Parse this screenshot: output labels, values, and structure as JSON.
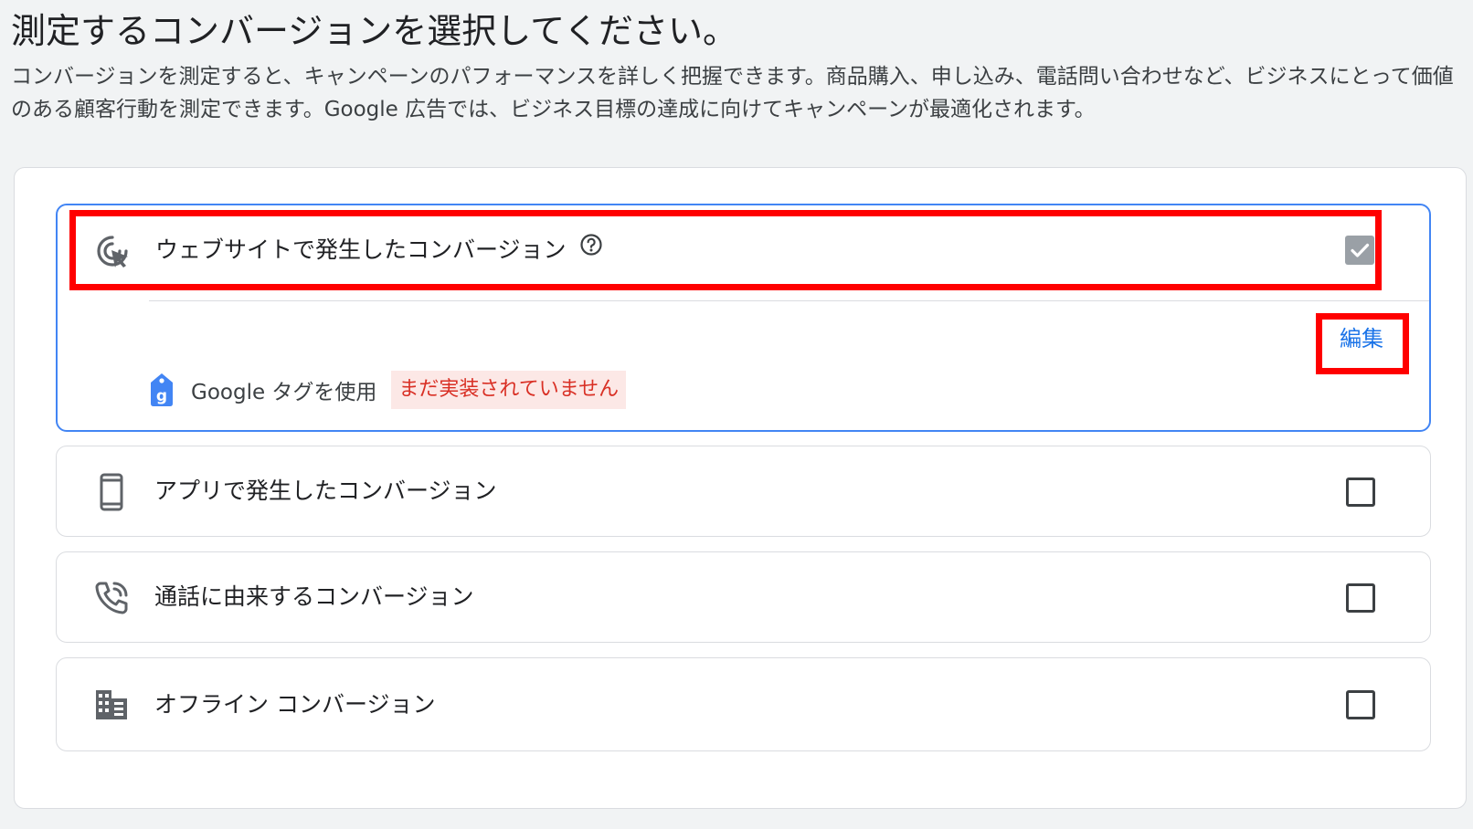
{
  "header": {
    "title": "測定するコンバージョンを選択してください。",
    "description": "コンバージョンを測定すると、キャンペーンのパフォーマンスを詳しく把握できます。商品購入、申し込み、電話問い合わせなど、ビジネスにとって価値のある顧客行動を測定できます。Google 広告では、ビジネス目標の達成に向けてキャンペーンが最適化されます。"
  },
  "options": [
    {
      "label": "ウェブサイトで発生したコンバージョン",
      "icon": "cursor-click-icon",
      "checked": true,
      "disabled": true,
      "expanded": true,
      "edit_label": "編集",
      "tag_label": "Google タグを使用",
      "tag_status": "まだ実装されていません"
    },
    {
      "label": "アプリで発生したコンバージョン",
      "icon": "smartphone-icon",
      "checked": false
    },
    {
      "label": "通話に由来するコンバージョン",
      "icon": "phone-in-talk-icon",
      "checked": false
    },
    {
      "label": "オフライン コンバージョン",
      "icon": "building-icon",
      "checked": false
    }
  ],
  "colors": {
    "accent": "#1a73e8",
    "selected_border": "#4285f4",
    "error_text": "#d93025",
    "error_bg": "#fce8e6",
    "annotation": "#ff0000"
  }
}
